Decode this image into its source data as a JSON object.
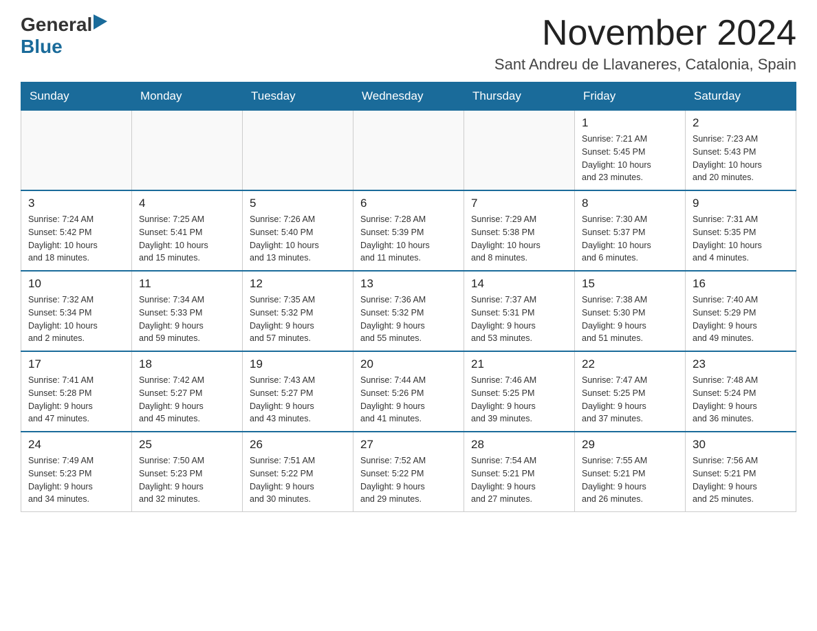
{
  "logo": {
    "general": "General",
    "blue": "Blue"
  },
  "title": "November 2024",
  "subtitle": "Sant Andreu de Llavaneres, Catalonia, Spain",
  "weekdays": [
    "Sunday",
    "Monday",
    "Tuesday",
    "Wednesday",
    "Thursday",
    "Friday",
    "Saturday"
  ],
  "weeks": [
    [
      {
        "day": "",
        "info": ""
      },
      {
        "day": "",
        "info": ""
      },
      {
        "day": "",
        "info": ""
      },
      {
        "day": "",
        "info": ""
      },
      {
        "day": "",
        "info": ""
      },
      {
        "day": "1",
        "info": "Sunrise: 7:21 AM\nSunset: 5:45 PM\nDaylight: 10 hours\nand 23 minutes."
      },
      {
        "day": "2",
        "info": "Sunrise: 7:23 AM\nSunset: 5:43 PM\nDaylight: 10 hours\nand 20 minutes."
      }
    ],
    [
      {
        "day": "3",
        "info": "Sunrise: 7:24 AM\nSunset: 5:42 PM\nDaylight: 10 hours\nand 18 minutes."
      },
      {
        "day": "4",
        "info": "Sunrise: 7:25 AM\nSunset: 5:41 PM\nDaylight: 10 hours\nand 15 minutes."
      },
      {
        "day": "5",
        "info": "Sunrise: 7:26 AM\nSunset: 5:40 PM\nDaylight: 10 hours\nand 13 minutes."
      },
      {
        "day": "6",
        "info": "Sunrise: 7:28 AM\nSunset: 5:39 PM\nDaylight: 10 hours\nand 11 minutes."
      },
      {
        "day": "7",
        "info": "Sunrise: 7:29 AM\nSunset: 5:38 PM\nDaylight: 10 hours\nand 8 minutes."
      },
      {
        "day": "8",
        "info": "Sunrise: 7:30 AM\nSunset: 5:37 PM\nDaylight: 10 hours\nand 6 minutes."
      },
      {
        "day": "9",
        "info": "Sunrise: 7:31 AM\nSunset: 5:35 PM\nDaylight: 10 hours\nand 4 minutes."
      }
    ],
    [
      {
        "day": "10",
        "info": "Sunrise: 7:32 AM\nSunset: 5:34 PM\nDaylight: 10 hours\nand 2 minutes."
      },
      {
        "day": "11",
        "info": "Sunrise: 7:34 AM\nSunset: 5:33 PM\nDaylight: 9 hours\nand 59 minutes."
      },
      {
        "day": "12",
        "info": "Sunrise: 7:35 AM\nSunset: 5:32 PM\nDaylight: 9 hours\nand 57 minutes."
      },
      {
        "day": "13",
        "info": "Sunrise: 7:36 AM\nSunset: 5:32 PM\nDaylight: 9 hours\nand 55 minutes."
      },
      {
        "day": "14",
        "info": "Sunrise: 7:37 AM\nSunset: 5:31 PM\nDaylight: 9 hours\nand 53 minutes."
      },
      {
        "day": "15",
        "info": "Sunrise: 7:38 AM\nSunset: 5:30 PM\nDaylight: 9 hours\nand 51 minutes."
      },
      {
        "day": "16",
        "info": "Sunrise: 7:40 AM\nSunset: 5:29 PM\nDaylight: 9 hours\nand 49 minutes."
      }
    ],
    [
      {
        "day": "17",
        "info": "Sunrise: 7:41 AM\nSunset: 5:28 PM\nDaylight: 9 hours\nand 47 minutes."
      },
      {
        "day": "18",
        "info": "Sunrise: 7:42 AM\nSunset: 5:27 PM\nDaylight: 9 hours\nand 45 minutes."
      },
      {
        "day": "19",
        "info": "Sunrise: 7:43 AM\nSunset: 5:27 PM\nDaylight: 9 hours\nand 43 minutes."
      },
      {
        "day": "20",
        "info": "Sunrise: 7:44 AM\nSunset: 5:26 PM\nDaylight: 9 hours\nand 41 minutes."
      },
      {
        "day": "21",
        "info": "Sunrise: 7:46 AM\nSunset: 5:25 PM\nDaylight: 9 hours\nand 39 minutes."
      },
      {
        "day": "22",
        "info": "Sunrise: 7:47 AM\nSunset: 5:25 PM\nDaylight: 9 hours\nand 37 minutes."
      },
      {
        "day": "23",
        "info": "Sunrise: 7:48 AM\nSunset: 5:24 PM\nDaylight: 9 hours\nand 36 minutes."
      }
    ],
    [
      {
        "day": "24",
        "info": "Sunrise: 7:49 AM\nSunset: 5:23 PM\nDaylight: 9 hours\nand 34 minutes."
      },
      {
        "day": "25",
        "info": "Sunrise: 7:50 AM\nSunset: 5:23 PM\nDaylight: 9 hours\nand 32 minutes."
      },
      {
        "day": "26",
        "info": "Sunrise: 7:51 AM\nSunset: 5:22 PM\nDaylight: 9 hours\nand 30 minutes."
      },
      {
        "day": "27",
        "info": "Sunrise: 7:52 AM\nSunset: 5:22 PM\nDaylight: 9 hours\nand 29 minutes."
      },
      {
        "day": "28",
        "info": "Sunrise: 7:54 AM\nSunset: 5:21 PM\nDaylight: 9 hours\nand 27 minutes."
      },
      {
        "day": "29",
        "info": "Sunrise: 7:55 AM\nSunset: 5:21 PM\nDaylight: 9 hours\nand 26 minutes."
      },
      {
        "day": "30",
        "info": "Sunrise: 7:56 AM\nSunset: 5:21 PM\nDaylight: 9 hours\nand 25 minutes."
      }
    ]
  ]
}
